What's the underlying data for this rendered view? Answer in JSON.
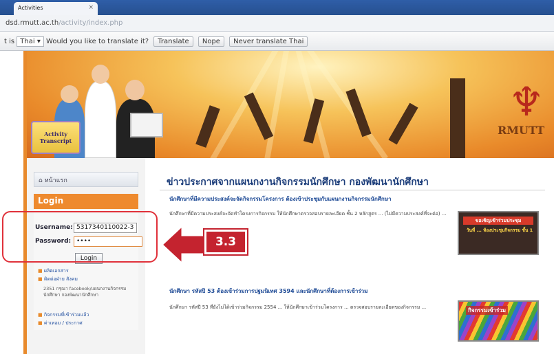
{
  "browser": {
    "tab_title": "Activities",
    "tab_close": "×",
    "url_host": "dsd.rmutt.ac.th",
    "url_path": "/activity/index.php"
  },
  "translate_bar": {
    "prefix": "t is",
    "language": "Thai",
    "question": "Would you like to translate it?",
    "translate_btn": "Translate",
    "nope_btn": "Nope",
    "never_btn": "Never translate Thai"
  },
  "banner": {
    "badge_line1": "Activity",
    "badge_line2": "Transcript",
    "logo_text": "RMUTT"
  },
  "sidebar": {
    "home_label": "หน้าแรก",
    "login_title": "Login",
    "username_label": "Username:",
    "username_value": "5317340110022-3",
    "password_label": "Password:",
    "password_value": "••••",
    "login_button": "Login",
    "links": [
      "ผลิตเอกสาร",
      "ติดต่อฝ่าย สังคม",
      "กิจกรรมที่เข้าร่วมแล้ว",
      "ค่าเทอม / ประกาศ"
    ],
    "contact_text": "2351 กรุณา facebook/แผนกงานกิจกรรม นักศึกษา กองพัฒนานักศึกษา"
  },
  "main": {
    "title": "ข่าวประกาศจากแผนกงานกิจกรรมนักศึกษา กองพัฒนานักศึกษา",
    "news": [
      {
        "title": "นักศึกษาที่มีความประสงค์จะจัดกิจกรรมโครงการ ต้องเข้าประชุมกับแผนกงานกิจกรรมนักศึกษา",
        "body": "นักศึกษาที่มีความประสงค์จะจัดทำโครงการกิจกรรม ให้นักศึกษาตรวจสอบรายละเอียด ชั้น 2 หลักสูตร ... (ไม่มีความประสงค์ที่จะต่อ) ...",
        "thumb_line1": "ขอเชิญเข้าร่วมประชุม",
        "thumb_line2": "วันที่ ... ห้องประชุมกิจกรรม ชั้น 1"
      },
      {
        "title": "นักศึกษา รหัสปี 53 ต้องเข้าร่วมการปฐมนิเทศ 3594 และนักศึกษาที่ต้องการเข้าร่วม",
        "body": "นักศึกษา รหัสปี 53 ที่ยังไม่ได้เข้าร่วมกิจกรรม 2554 ... ให้นักศึกษาเข้าร่วมโครงการ ... ตรวจสอบรายละเอียดของกิจกรรม ...",
        "thumb_line1": "กิจกรรมเข้าร่วม"
      }
    ]
  },
  "annotation": {
    "step": "3.3",
    "highlight_color": "#e0313a",
    "badge_color": "#c4232f"
  }
}
